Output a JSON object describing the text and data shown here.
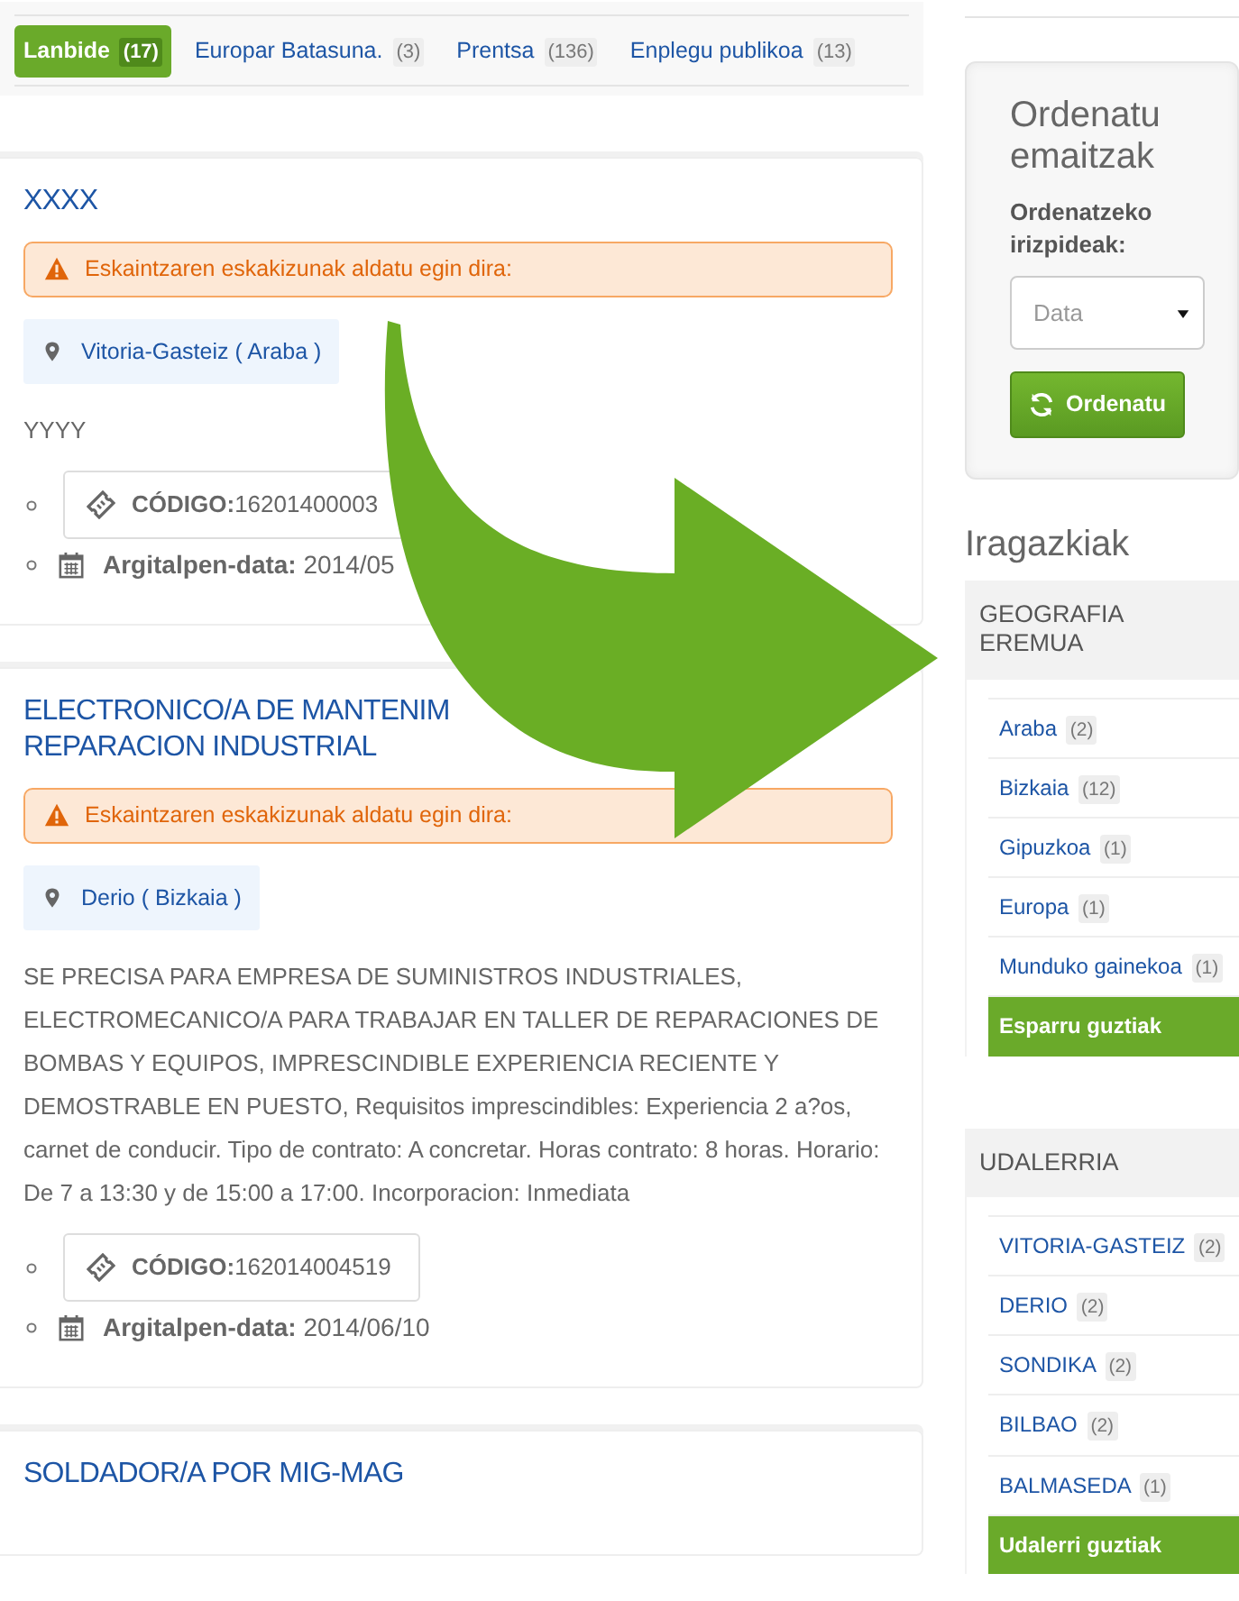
{
  "source_tabs": [
    {
      "label": "Lanbide",
      "count": "(17)",
      "selected": true
    },
    {
      "label": "Europar Batasuna.",
      "count": "(3)",
      "selected": false
    },
    {
      "label": "Prentsa",
      "count": "(136)",
      "selected": false
    },
    {
      "label": "Enplegu publikoa",
      "count": "(13)",
      "selected": false
    }
  ],
  "offers": [
    {
      "title_lines": [
        "XXXX"
      ],
      "warning": "Eskaintzaren eskakizunak aldatu egin dira:",
      "location": "Vitoria-Gasteiz ( Araba )",
      "description": "YYYY",
      "code_label": "CÓDIGO:",
      "code": "16201400003",
      "date_label": "Argitalpen-data:",
      "date": "2014/05"
    },
    {
      "title_lines": [
        "ELECTRONICO/A DE MANTENIM",
        "REPARACION INDUSTRIAL"
      ],
      "warning": "Eskaintzaren eskakizunak aldatu egin dira:",
      "location": "Derio ( Bizkaia )",
      "description": "SE PRECISA PARA EMPRESA DE SUMINISTROS INDUSTRIALES, ELECTROMECANICO/A PARA TRABAJAR EN TALLER DE REPARACIONES DE BOMBAS Y EQUIPOS, IMPRESCINDIBLE EXPERIENCIA RECIENTE Y DEMOSTRABLE EN PUESTO, Requisitos imprescindibles: Experiencia 2 a?os, carnet de conducir. Tipo de contrato: A concretar. Horas contrato: 8 horas. Horario: De 7 a 13:30 y de 15:00 a 17:00. Incorporacion: Inmediata",
      "code_label": "CÓDIGO:",
      "code": "162014004519",
      "date_label": "Argitalpen-data:",
      "date": "2014/06/10"
    },
    {
      "title_lines": [
        "SOLDADOR/A POR MIG-MAG"
      ]
    }
  ],
  "sort_panel": {
    "title": "Ordenatu emaitzak",
    "label": "Ordenatzeko irizpideak:",
    "value": "Data",
    "button": "Ordenatu"
  },
  "filters_title": "Iragazkiak",
  "filter_groups": [
    {
      "title": "GEOGRAFIA EREMUA",
      "items": [
        {
          "label": "Araba",
          "count": "(2)",
          "selected": false
        },
        {
          "label": "Bizkaia",
          "count": "(12)",
          "selected": false
        },
        {
          "label": "Gipuzkoa",
          "count": "(1)",
          "selected": false
        },
        {
          "label": "Europa",
          "count": "(1)",
          "selected": false
        },
        {
          "label": "Munduko gainekoa",
          "count": "(1)",
          "selected": false
        },
        {
          "label": "Esparru guztiak",
          "selected": true
        }
      ]
    },
    {
      "title": "UDALERRIA",
      "items": [
        {
          "label": "VITORIA-GASTEIZ",
          "count": "(2)",
          "selected": false
        },
        {
          "label": "DERIO",
          "count": "(2)",
          "selected": false
        },
        {
          "label": "SONDIKA",
          "count": "(2)",
          "selected": false
        },
        {
          "label": "BILBAO",
          "count": "(2)",
          "selected": false
        },
        {
          "label": "BALMASEDA",
          "count": "(1)",
          "selected": false
        },
        {
          "label": "Udalerri guztiak",
          "selected": true
        }
      ]
    }
  ]
}
